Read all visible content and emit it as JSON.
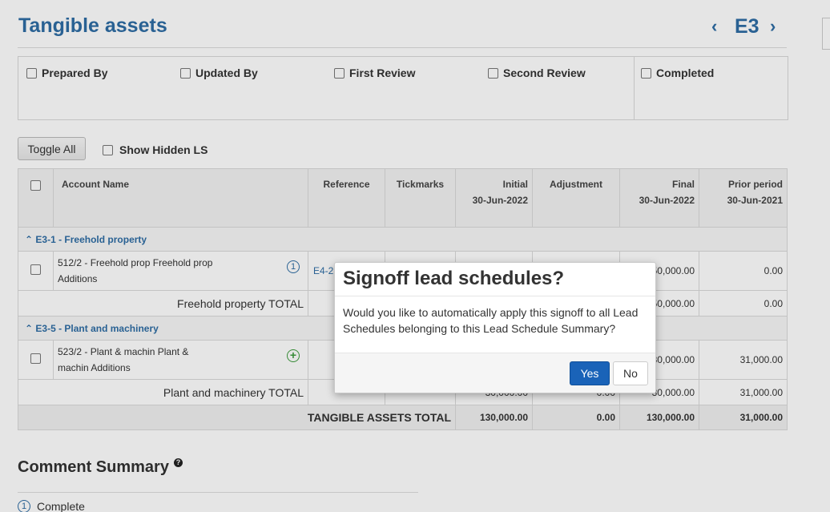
{
  "header": {
    "title": "Tangible assets",
    "code": "E3",
    "prev_glyph": "‹",
    "next_glyph": "›"
  },
  "signoff": {
    "prepared_by": "Prepared By",
    "updated_by": "Updated By",
    "first_review": "First Review",
    "second_review": "Second Review",
    "completed": "Completed"
  },
  "toolbar": {
    "toggle_all": "Toggle All",
    "show_hidden": "Show Hidden LS"
  },
  "table": {
    "headers": {
      "account_name": "Account Name",
      "reference": "Reference",
      "tickmarks": "Tickmarks",
      "initial": "Initial",
      "initial_date": "30-Jun-2022",
      "adjustment": "Adjustment",
      "final": "Final",
      "final_date": "30-Jun-2022",
      "prior": "Prior period",
      "prior_date": "30-Jun-2021"
    },
    "sections": [
      {
        "label": "E3-1 - Freehold property",
        "rows": [
          {
            "name": "512/2 - Freehold prop Freehold prop Additions",
            "reference": "E4-2",
            "final": "50,000.00",
            "prior": "0.00"
          }
        ],
        "total_label": "Freehold property TOTAL",
        "total_final": "50,000.00",
        "total_prior": "0.00"
      },
      {
        "label": "E3-5 - Plant and machinery",
        "rows": [
          {
            "name": "523/2 - Plant & machin Plant & machin Additions",
            "reference": "",
            "final": "30,000.00",
            "prior": "31,000.00"
          }
        ],
        "total_label": "Plant and machinery TOTAL",
        "total_initial": "30,000.00",
        "total_adjustment": "0.00",
        "total_final": "30,000.00",
        "total_prior": "31,000.00"
      }
    ],
    "grand": {
      "label": "TANGIBLE ASSETS TOTAL",
      "initial": "130,000.00",
      "adjustment": "0.00",
      "final": "130,000.00",
      "prior": "31,000.00"
    }
  },
  "comments": {
    "title": "Comment Summary",
    "help": "?",
    "items": [
      {
        "number": "1",
        "label": "Complete"
      }
    ]
  },
  "modal": {
    "title": "Signoff lead schedules?",
    "body": "Would you like to automatically apply this signoff to all Lead Schedules belonging to this Lead Schedule Summary?",
    "yes": "Yes",
    "no": "No"
  },
  "icons": {
    "collapse": "caret-up-icon",
    "status_complete": "circle-1-icon",
    "status_add": "circle-plus-icon",
    "collapse_glyph": "⌃",
    "badge_one": "1",
    "badge_plus": "+"
  },
  "colors": {
    "accent": "#2e6da4",
    "primary_button": "#1a63b8",
    "add_green": "#3c9a3c"
  }
}
